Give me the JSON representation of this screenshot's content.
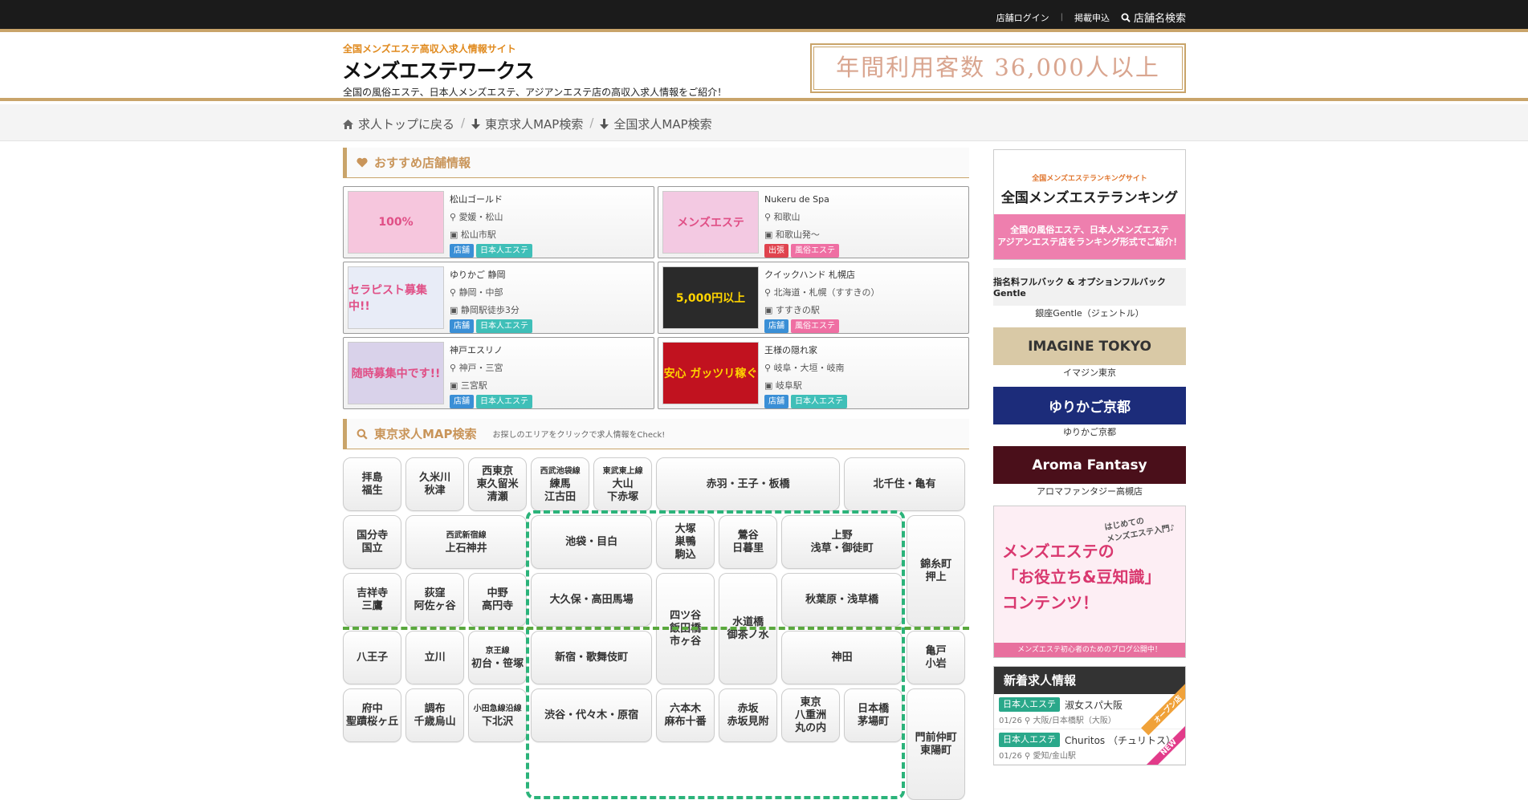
{
  "topbar": {
    "login": "店舗ログイン",
    "sep": "|",
    "apply": "掲載申込",
    "search": "店舗名検索"
  },
  "header": {
    "tagline": "全国メンズエステ高収入求人情報サイト",
    "logo": "メンズエステワークス",
    "desc": "全国の風俗エステ、日本人メンズエステ、アジアンエステ店の高収入求人情報をご紹介！",
    "banner": "年間利用客数 36,000人以上"
  },
  "nav": {
    "items": [
      "求人トップに戻る",
      "東京求人MAP検索",
      "全国求人MAP検索"
    ],
    "sep": "/"
  },
  "recommend": {
    "title": "おすすめ店舗情報",
    "shops": [
      {
        "name": "松山ゴールド",
        "area": "愛媛・松山",
        "station": "松山市駅",
        "type": "店舗",
        "genre": "日本人エステ",
        "thumb": "100%",
        "thumb_color": "#f6c6dd",
        "type_color": "#3a8fd6",
        "genre_color": "#3fbfb8"
      },
      {
        "name": "Nukeru de Spa",
        "area": "和歌山",
        "station": "和歌山発～",
        "type": "出張",
        "genre": "風俗エステ",
        "thumb": "メンズエステ",
        "thumb_color": "#f3c9e2",
        "type_color": "#e0434e",
        "genre_color": "#ef6fa3"
      },
      {
        "name": "ゆりかご 静岡",
        "area": "静岡・中部",
        "station": "静岡駅徒歩3分",
        "type": "店舗",
        "genre": "日本人エステ",
        "thumb": "セラピスト募集中!!",
        "thumb_color": "#e8ecf7",
        "type_color": "#3a8fd6",
        "genre_color": "#3fbfb8"
      },
      {
        "name": "クイックハンド 札幌店",
        "area": "北海道・札幌（すすきの）",
        "station": "すすきの駅",
        "type": "店舗",
        "genre": "風俗エステ",
        "thumb": "5,000円以上",
        "thumb_color": "#2a2a2a",
        "type_color": "#3a8fd6",
        "genre_color": "#ef6fa3"
      },
      {
        "name": "神戸エスリノ",
        "area": "神戸・三宮",
        "station": "三宮駅",
        "type": "店舗",
        "genre": "日本人エステ",
        "thumb": "随時募集中です!!",
        "thumb_color": "#d9d2ea",
        "type_color": "#3a8fd6",
        "genre_color": "#3fbfb8"
      },
      {
        "name": "王様の隠れ家",
        "area": "岐阜・大垣・岐南",
        "station": "岐阜駅",
        "type": "店舗",
        "genre": "日本人エステ",
        "thumb": "安心 ガッツリ稼ぐ",
        "thumb_color": "#c1121f",
        "type_color": "#3a8fd6",
        "genre_color": "#3fbfb8"
      }
    ]
  },
  "map": {
    "title": "東京求人MAP検索",
    "sub": "お探しのエリアをクリックで求人情報をCheck!",
    "areas": [
      {
        "line": "",
        "text": "拝島\n福生"
      },
      {
        "line": "",
        "text": "久米川\n秋津"
      },
      {
        "line": "",
        "text": "西東京\n東久留米\n清瀬"
      },
      {
        "line": "西武池袋線",
        "text": "練馬\n江古田"
      },
      {
        "line": "東武東上線",
        "text": "大山\n下赤塚"
      },
      {
        "line": "",
        "text": "赤羽・王子・板橋"
      },
      {
        "line": "",
        "text": "北千住・亀有"
      },
      {
        "line": "",
        "text": "国分寺\n国立"
      },
      {
        "line": "西武新宿線",
        "text": "上石神井"
      },
      {
        "line": "",
        "text": "池袋・目白"
      },
      {
        "line": "",
        "text": "大塚\n巣鴨\n駒込"
      },
      {
        "line": "",
        "text": "鶯谷\n日暮里"
      },
      {
        "line": "",
        "text": "上野\n浅草・御徒町"
      },
      {
        "line": "",
        "text": "錦糸町\n押上"
      },
      {
        "line": "",
        "text": "吉祥寺\n三鷹"
      },
      {
        "line": "",
        "text": "荻窪\n阿佐ヶ谷"
      },
      {
        "line": "",
        "text": "中野\n高円寺"
      },
      {
        "line": "",
        "text": "大久保・高田馬場"
      },
      {
        "line": "",
        "text": "四ツ谷\n飯田橋\n市ヶ谷"
      },
      {
        "line": "",
        "text": "水道橋\n御茶ノ水"
      },
      {
        "line": "",
        "text": "秋葉原・浅草橋"
      },
      {
        "line": "",
        "text": "八王子"
      },
      {
        "line": "",
        "text": "立川"
      },
      {
        "line": "京王線",
        "text": "初台・笹塚"
      },
      {
        "line": "",
        "text": "新宿・歌舞伎町"
      },
      {
        "line": "",
        "text": "神田"
      },
      {
        "line": "",
        "text": "亀戸\n小岩"
      },
      {
        "line": "",
        "text": "府中\n聖蹟桜ヶ丘"
      },
      {
        "line": "",
        "text": "調布\n千歳烏山"
      },
      {
        "line": "小田急線沿線",
        "text": "下北沢"
      },
      {
        "line": "",
        "text": "渋谷・代々木・原宿"
      },
      {
        "line": "",
        "text": "六本木\n麻布十番"
      },
      {
        "line": "",
        "text": "赤坂\n赤坂見附"
      },
      {
        "line": "",
        "text": "東京\n八重洲\n丸の内"
      },
      {
        "line": "",
        "text": "日本橋\n茅場町"
      },
      {
        "line": "",
        "text": "門前仲町\n東陽町"
      }
    ]
  },
  "sidebar": {
    "rank_tiny": "全国メンズエステランキングサイト",
    "rank_big": "全国メンズエステランキング",
    "rank_desc": "全国の風俗エステ、日本人メンズエステ\nアジアンエステ店をランキング形式でご紹介！",
    "banners": [
      {
        "text": "指名料フルバック & オプションフルバック　Gentle",
        "caption": "銀座Gentle（ジェントル）",
        "bg": "#f1f1f1",
        "color": "#222"
      },
      {
        "text": "IMAGINE TOKYO",
        "caption": "イマジン東京",
        "bg": "#d9c9a6",
        "color": "#333"
      },
      {
        "text": "ゆりかご京都",
        "caption": "ゆりかご京都",
        "bg": "#1c2c7a",
        "color": "#fff"
      },
      {
        "text": "Aroma Fantasy",
        "caption": "アロマファンタジー高槻店",
        "bg": "#4a0f1a",
        "color": "#fff"
      }
    ],
    "blog_badge": "はじめての\nメンズエステ入門♪",
    "blog_title": "メンズエステの\n「お役立ち&豆知識」\nコンテンツ！",
    "blog_footer": "メンズエステ初心者のためのブログ公開中！",
    "new_title": "新着求人情報",
    "jobs": [
      {
        "genre": "日本人エステ",
        "name": "淑女スパ大阪",
        "date": "01/26",
        "place": "大阪/日本橋駅（大阪）"
      },
      {
        "genre": "日本人エステ",
        "name": "Churitos （チュリトス）",
        "date": "01/26",
        "place": "愛知/金山駅"
      }
    ],
    "ribbon1": "オープン店",
    "ribbon2": "NEW"
  }
}
